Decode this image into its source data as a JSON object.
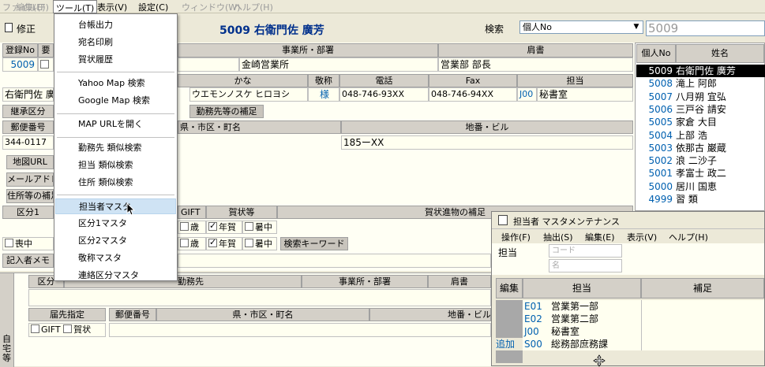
{
  "menubar": {
    "items": [
      "ファイル(F)",
      "編集(E)",
      "ツール(T)",
      "表示(V)",
      "設定(C)",
      "ウィンドウ(W)",
      "ヘルプ(H)"
    ]
  },
  "toolbar": {
    "mode_label": "修正",
    "record_title": "5009 右衛門佐 廣芳",
    "search_label": "検索",
    "search_field": "個人No",
    "search_value": "5009"
  },
  "tools_menu": {
    "group1": [
      "台帳出力",
      "宛名印刷",
      "賀状履歴"
    ],
    "group2": [
      "Yahoo Map 検索",
      "Google Map 検索"
    ],
    "group3": [
      "MAP URLを開く"
    ],
    "group4": [
      "勤務先 類似検索",
      "担当 類似検索",
      "住所 類似検索"
    ],
    "group5": [
      "担当者マスタ",
      "区分1マスタ",
      "区分2マスタ",
      "敬称マスタ",
      "連絡区分マスタ"
    ]
  },
  "form": {
    "h_regno": "登録No",
    "h_req": "要",
    "h_office": "事業所・部署",
    "h_title": "肩書",
    "regno": "5009",
    "office": "金崎営業所",
    "title": "営業部 部長",
    "h_kana": "かな",
    "h_honor": "敬称",
    "h_tel": "電話",
    "h_fax": "Fax",
    "h_staff": "担当",
    "name_partial": "右衛門佐 廣",
    "kana": "ウエモンノスケ ヒロヨシ",
    "honor": "様",
    "tel": "048-746-93XX",
    "fax": "048-746-94XX",
    "staff_code": "J00",
    "staff_name": "秘書室",
    "h_contact": "継承区分",
    "btn_work_note": "勤務先等の補足",
    "h_zip": "郵便番号",
    "h_pref": "県・市区・町名",
    "h_bldg": "地番・ビル",
    "zip": "344-0117",
    "bldg": "185ーXX",
    "btn_mapurl": "地図URL",
    "btn_mail": "メールアドレス",
    "btn_addr_note": "住所等の補足",
    "h_kubun1": "区分1",
    "h_gift": "GIFT",
    "h_ga": "賀状等",
    "h_ga_note": "賀状進物の補足",
    "c_sai": "歳",
    "c_nenga": "年賀",
    "c_shochu": "暑中",
    "c_mochu": "喪中",
    "btn_keyword": "検索キーワード",
    "h_memo": "記入者メモ"
  },
  "home": {
    "side_label": "自宅等",
    "h_kubun": "区分",
    "h_work": "勤務先",
    "h_office": "事業所・部署",
    "h_title": "肩書",
    "h_delivery": "届先指定",
    "c_gift": "GIFT",
    "c_ga": "賀状",
    "h_zip": "郵便番号",
    "h_pref": "県・市区・町名",
    "h_bldg": "地番・ビル"
  },
  "list": {
    "h_no": "個人No",
    "h_name": "姓名",
    "rows": [
      {
        "no": "5009",
        "name": "右衛門佐 廣芳",
        "selected": true
      },
      {
        "no": "5008",
        "name": "滝上 阿郎"
      },
      {
        "no": "5007",
        "name": "八月朔 宜弘"
      },
      {
        "no": "5006",
        "name": "三戸谷 請安"
      },
      {
        "no": "5005",
        "name": "家倉 大目"
      },
      {
        "no": "5004",
        "name": "上部 浩"
      },
      {
        "no": "5003",
        "name": "依那古 巌蔵"
      },
      {
        "no": "5002",
        "name": "浪 二沙子"
      },
      {
        "no": "5001",
        "name": "孝富士 政二"
      },
      {
        "no": "5000",
        "name": "居川 国恵"
      },
      {
        "no": "4999",
        "name": "習 類"
      }
    ]
  },
  "staff_master": {
    "title": "担当者 マスタメンテナンス",
    "menu": [
      "操作(F)",
      "抽出(S)",
      "編集(E)",
      "表示(V)",
      "ヘルプ(H)"
    ],
    "filter_label": "担当",
    "code_ph": "コード",
    "name_ph": "名",
    "h_edit": "編集",
    "h_staff": "担当",
    "h_note": "補足",
    "rows": [
      {
        "edit": "",
        "code": "E01",
        "name": "営業第一部"
      },
      {
        "edit": "",
        "code": "E02",
        "name": "営業第二部"
      },
      {
        "edit": "",
        "code": "J00",
        "name": "秘書室"
      },
      {
        "edit": "追加",
        "code": "S00",
        "name": "総務部庶務課"
      }
    ]
  },
  "colors": {
    "accent": "#0060b0",
    "title_blue": "#00308c",
    "menu_highlight": "#cfe3f4"
  }
}
